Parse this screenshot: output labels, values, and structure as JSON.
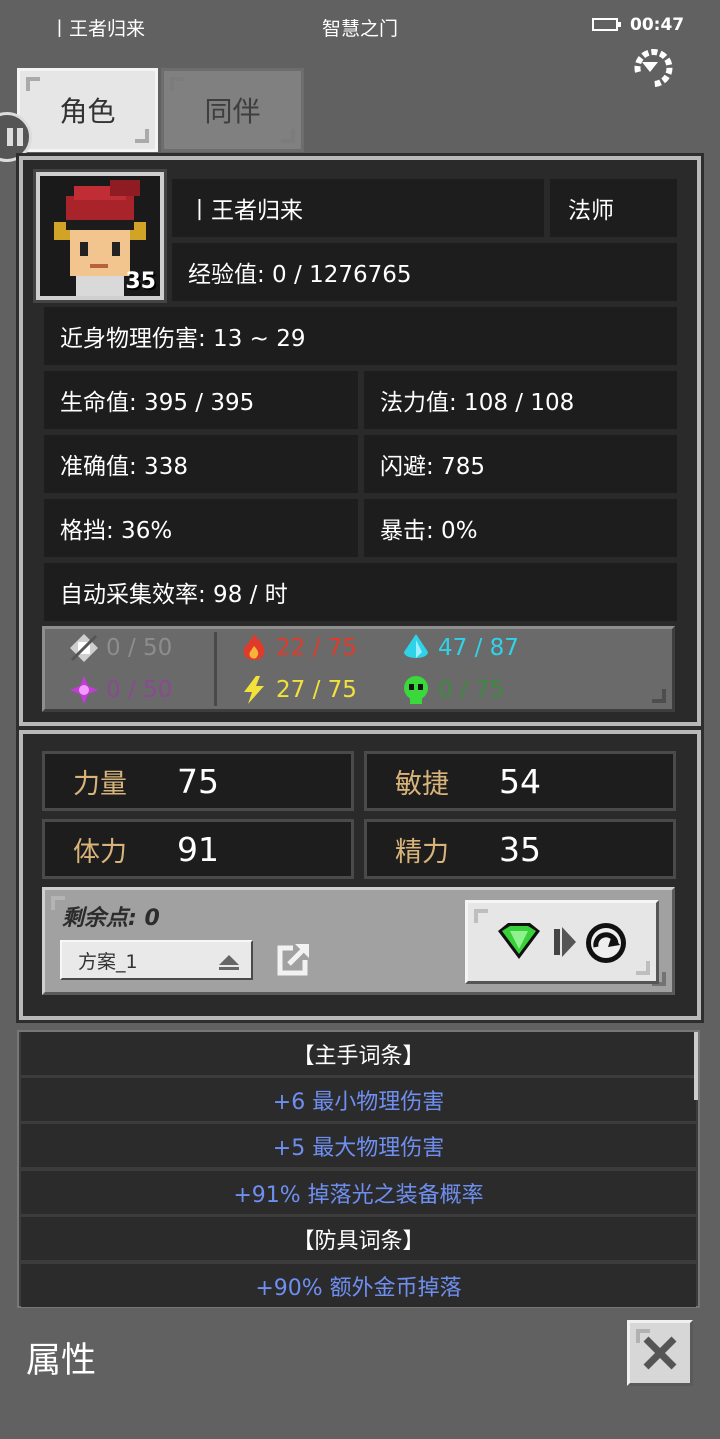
{
  "status_bar": {
    "player": "丨王者归来",
    "location": "智慧之门",
    "time": "00:47"
  },
  "tabs": [
    {
      "label": "角色",
      "active": true
    },
    {
      "label": "同伴",
      "active": false
    }
  ],
  "character": {
    "level": "35",
    "name": "丨王者归来",
    "class": "法师",
    "experience": "经验值: 0 / 1276765",
    "melee_damage": "近身物理伤害: 13 ~ 29",
    "hp": "生命值: 395 / 395",
    "mp": "法力值: 108 / 108",
    "accuracy": "准确值: 338",
    "dodge": "闪避: 785",
    "block": "格挡: 36%",
    "crit": "暴击: 0%",
    "gather_rate": "自动采集效率: 98 / 时"
  },
  "resistances": [
    {
      "icon": "physical-icon",
      "value": "0 / 50",
      "color": "#8d8d8d"
    },
    {
      "icon": "fire-icon",
      "value": "22 / 75",
      "color": "#e03b2a"
    },
    {
      "icon": "water-icon",
      "value": "47 / 87",
      "color": "#2fd3e8"
    },
    {
      "icon": "arcane-icon",
      "value": "0 / 50",
      "color": "#8a4a8f"
    },
    {
      "icon": "lightning-icon",
      "value": "27 / 75",
      "color": "#f2e23a"
    },
    {
      "icon": "poison-icon",
      "value": "0 / 75",
      "color": "#3f8a3f"
    }
  ],
  "attributes": [
    {
      "label": "力量",
      "value": "75"
    },
    {
      "label": "敏捷",
      "value": "54"
    },
    {
      "label": "体力",
      "value": "91"
    },
    {
      "label": "精力",
      "value": "35"
    }
  ],
  "points": {
    "remaining": "剩余点: 0",
    "plan": "方案_1"
  },
  "affixes": [
    {
      "text": "【主手词条】",
      "kind": "header"
    },
    {
      "text": "+6 最小物理伤害",
      "kind": "item"
    },
    {
      "text": "+5 最大物理伤害",
      "kind": "item"
    },
    {
      "text": "+91% 掉落光之装备概率",
      "kind": "item"
    },
    {
      "text": "【防具词条】",
      "kind": "header"
    },
    {
      "text": "+90% 额外金币掉落",
      "kind": "item"
    }
  ],
  "footer": {
    "title": "属性"
  },
  "colors": {
    "attr_label": "#d8b47a",
    "affix_item": "#6f8ff0",
    "panel_bg": "#2a2a2a"
  }
}
